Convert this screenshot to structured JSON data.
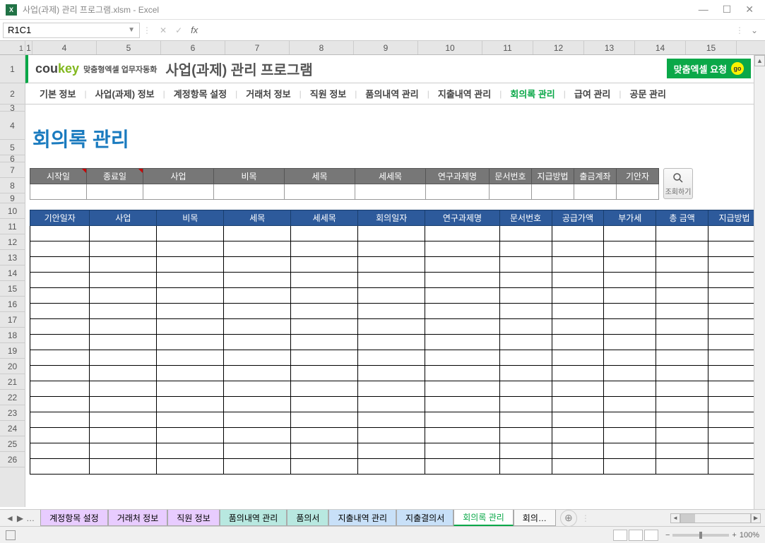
{
  "window": {
    "title": "사업(과제) 관리 프로그램.xlsm - Excel"
  },
  "nameBox": "R1C1",
  "colHeaders": [
    "1",
    "4",
    "5",
    "6",
    "7",
    "8",
    "9",
    "10",
    "11",
    "12",
    "13",
    "14",
    "15"
  ],
  "rowHeaders": [
    "1",
    "2",
    "3",
    "4",
    "5",
    "6",
    "7",
    "8",
    "9",
    "10",
    "11",
    "12",
    "13",
    "14",
    "15",
    "16",
    "17",
    "18",
    "19",
    "20",
    "21",
    "22",
    "23",
    "24",
    "25",
    "26"
  ],
  "app": {
    "logo1": "cou",
    "logo2": "key",
    "logoSub": "맞춤형엑셀 업무자동화",
    "title": "사업(과제) 관리 프로그램",
    "goLabel": "맞춤엑셀 요청",
    "goBadge": "go",
    "exLabel": "엑"
  },
  "nav": [
    "기본 정보",
    "사업(과제) 정보",
    "계정항목 설정",
    "거래처 정보",
    "직원 정보",
    "품의내역 관리",
    "지출내역 관리",
    "회의록 관리",
    "급여 관리",
    "공문 관리"
  ],
  "navActive": "회의록 관리",
  "pageTitle": "회의록 관리",
  "filterHeaders": [
    "시작일",
    "종료일",
    "사업",
    "비목",
    "세목",
    "세세목",
    "연구과제명",
    "문서번호",
    "지급방법",
    "출금계좌",
    "기안자"
  ],
  "searchLabel": "조회하기",
  "dataHeaders": [
    "기안일자",
    "사업",
    "비목",
    "세목",
    "세세목",
    "회의일자",
    "연구과제명",
    "문서번호",
    "공급가액",
    "부가세",
    "총 금액",
    "지급방법"
  ],
  "dataRowCount": 16,
  "sheetTabs": [
    {
      "label": "계정항목 설정",
      "cls": "t-purple"
    },
    {
      "label": "거래처 정보",
      "cls": "t-purple"
    },
    {
      "label": "직원 정보",
      "cls": "t-purple"
    },
    {
      "label": "품의내역 관리",
      "cls": "t-teal"
    },
    {
      "label": "품의서",
      "cls": "t-teal"
    },
    {
      "label": "지출내역 관리",
      "cls": "t-blue"
    },
    {
      "label": "지출결의서",
      "cls": "t-blue"
    },
    {
      "label": "회의록 관리",
      "cls": "t-active"
    },
    {
      "label": "회의…",
      "cls": ""
    }
  ],
  "zoom": "100%"
}
